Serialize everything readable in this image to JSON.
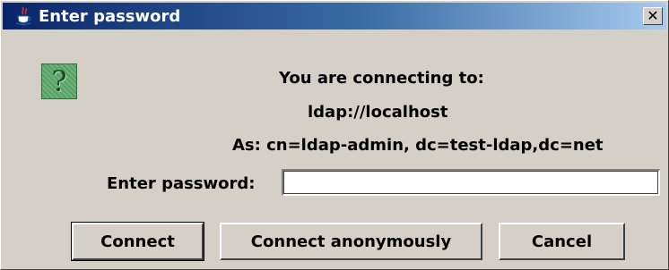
{
  "window": {
    "title": "Enter password",
    "close_symbol": "✕",
    "icon": "java-cup-icon"
  },
  "dialog": {
    "icon": "question-icon",
    "icon_glyph": "?",
    "line1": "You are connecting to:",
    "line2": "ldap://localhost",
    "line3": "As: cn=ldap-admin, dc=test-ldap,dc=net",
    "password_label": "Enter password:",
    "password_value": ""
  },
  "buttons": {
    "connect": "Connect",
    "connect_anonymously": "Connect anonymously",
    "cancel": "Cancel"
  },
  "colors": {
    "titlebar_start": "#0a246a",
    "titlebar_end": "#a6caf0",
    "face": "#d4d0c8",
    "icon_green": "#5aa86a"
  }
}
